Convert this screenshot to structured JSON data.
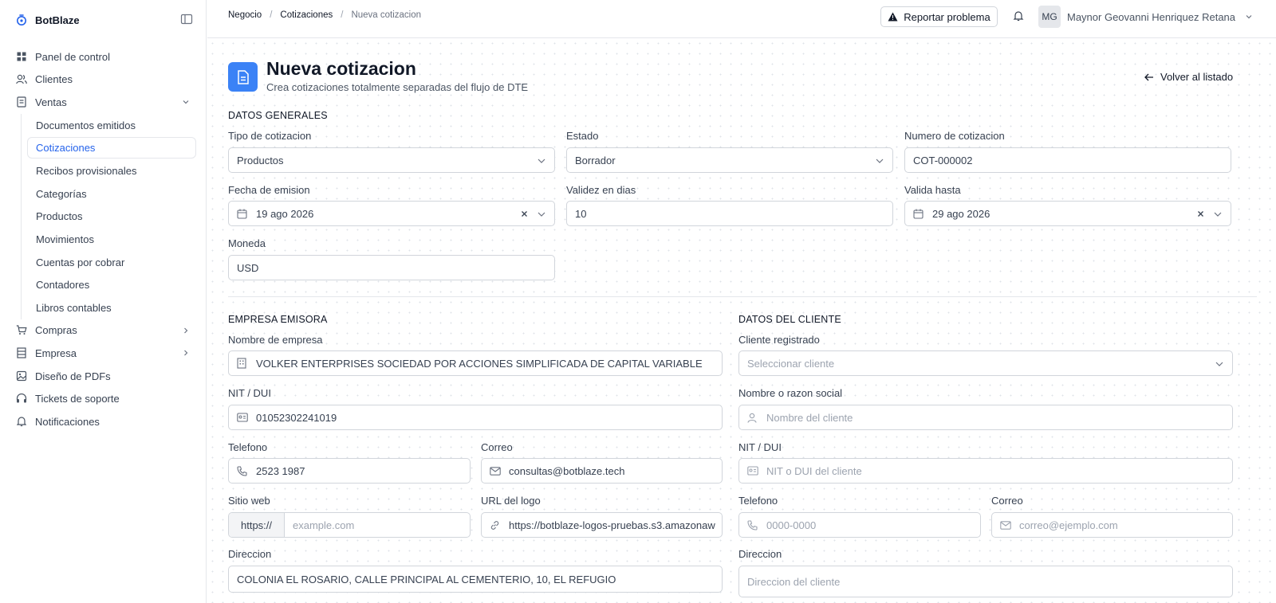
{
  "app": {
    "brand": "BotBlaze"
  },
  "sidebar": {
    "items": [
      {
        "label": "Panel de control"
      },
      {
        "label": "Clientes"
      },
      {
        "label": "Ventas"
      },
      {
        "label": "Compras"
      },
      {
        "label": "Empresa"
      },
      {
        "label": "Diseño de PDFs"
      },
      {
        "label": "Tickets de soporte"
      },
      {
        "label": "Notificaciones"
      }
    ],
    "ventas_sub": [
      {
        "label": "Documentos emitidos"
      },
      {
        "label": "Cotizaciones"
      },
      {
        "label": "Recibos provisionales"
      },
      {
        "label": "Categorías"
      },
      {
        "label": "Productos"
      },
      {
        "label": "Movimientos"
      },
      {
        "label": "Cuentas por cobrar"
      },
      {
        "label": "Contadores"
      },
      {
        "label": "Libros contables"
      }
    ]
  },
  "topbar": {
    "breadcrumb": [
      "Negocio",
      "Cotizaciones",
      "Nueva cotizacion"
    ],
    "report_button": "Reportar problema",
    "user_initials": "MG",
    "user_name": "Maynor Geovanni Henriquez Retana"
  },
  "page": {
    "title": "Nueva cotizacion",
    "subtitle": "Crea cotizaciones totalmente separadas del flujo de DTE",
    "back_link": "Volver al listado"
  },
  "general": {
    "section_title": "DATOS GENERALES",
    "tipo_label": "Tipo de cotizacion",
    "tipo_value": "Productos",
    "estado_label": "Estado",
    "estado_value": "Borrador",
    "numero_label": "Numero de cotizacion",
    "numero_value": "COT-000002",
    "fecha_label": "Fecha de emision",
    "fecha_value": "19 ago 2026",
    "validez_label": "Validez en dias",
    "validez_value": "10",
    "valida_label": "Valida hasta",
    "valida_value": "29 ago 2026",
    "moneda_label": "Moneda",
    "moneda_value": "USD"
  },
  "empresa": {
    "section_title": "EMPRESA EMISORA",
    "nombre_label": "Nombre de empresa",
    "nombre_value": "VOLKER ENTERPRISES SOCIEDAD POR ACCIONES SIMPLIFICADA DE CAPITAL VARIABLE",
    "nit_label": "NIT / DUI",
    "nit_value": "01052302241019",
    "telefono_label": "Telefono",
    "telefono_value": "2523 1987",
    "correo_label": "Correo",
    "correo_value": "consultas@botblaze.tech",
    "sitio_label": "Sitio web",
    "sitio_prefix": "https://",
    "sitio_placeholder": "example.com",
    "logo_label": "URL del logo",
    "logo_value": "https://botblaze-logos-pruebas.s3.amazonaw",
    "direccion_label": "Direccion",
    "direccion_value": "COLONIA EL ROSARIO, CALLE PRINCIPAL AL CEMENTERIO, 10, EL REFUGIO"
  },
  "cliente": {
    "section_title": "DATOS DEL CLIENTE",
    "registrado_label": "Cliente registrado",
    "registrado_placeholder": "Seleccionar cliente",
    "nombre_label": "Nombre o razon social",
    "nombre_placeholder": "Nombre del cliente",
    "nit_label": "NIT / DUI",
    "nit_placeholder": "NIT o DUI del cliente",
    "telefono_label": "Telefono",
    "telefono_placeholder": "0000-0000",
    "correo_label": "Correo",
    "correo_placeholder": "correo@ejemplo.com",
    "direccion_label": "Direccion",
    "direccion_placeholder": "Direccion del cliente"
  },
  "colors": {
    "accent": "#2563eb",
    "icon_bg": "#3b82f6"
  }
}
